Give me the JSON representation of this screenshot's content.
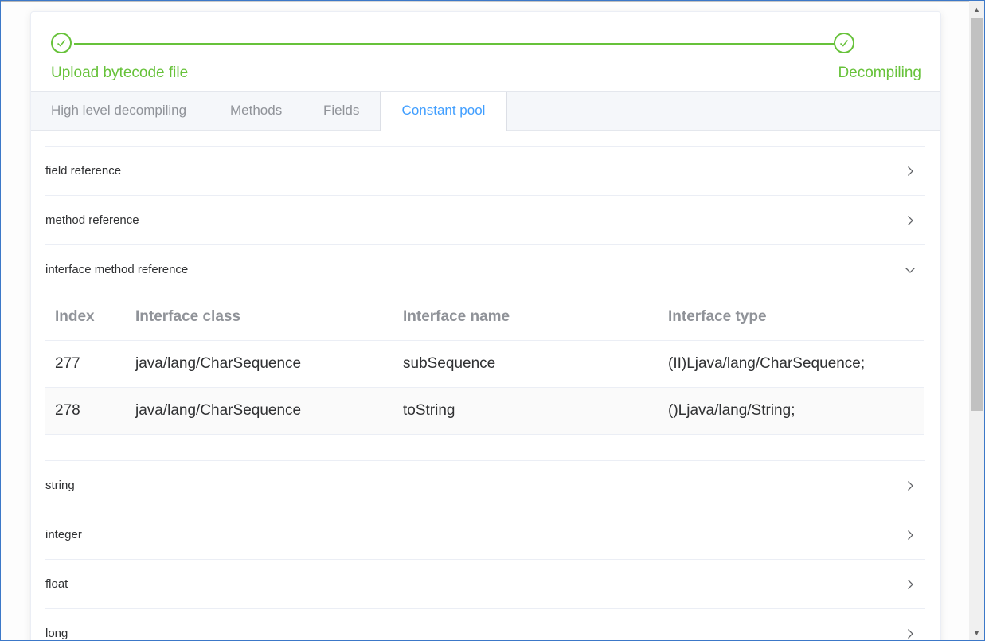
{
  "steps": [
    {
      "title": "Upload bytecode file",
      "status": "success"
    },
    {
      "title": "Decompiling",
      "status": "success"
    }
  ],
  "tabs": [
    {
      "label": "High level decompiling",
      "active": false
    },
    {
      "label": "Methods",
      "active": false
    },
    {
      "label": "Fields",
      "active": false
    },
    {
      "label": "Constant pool",
      "active": true
    }
  ],
  "collapse": {
    "items": [
      {
        "label": "field reference",
        "expanded": false
      },
      {
        "label": "method reference",
        "expanded": false
      },
      {
        "label": "interface method reference",
        "expanded": true
      },
      {
        "label": "string",
        "expanded": false
      },
      {
        "label": "integer",
        "expanded": false
      },
      {
        "label": "float",
        "expanded": false
      },
      {
        "label": "long",
        "expanded": false
      }
    ]
  },
  "interface_table": {
    "columns": [
      "Index",
      "Interface class",
      "Interface name",
      "Interface type"
    ],
    "rows": [
      [
        "277",
        "java/lang/CharSequence",
        "subSequence",
        "(II)Ljava/lang/CharSequence;"
      ],
      [
        "278",
        "java/lang/CharSequence",
        "toString",
        "()Ljava/lang/String;"
      ]
    ]
  },
  "colors": {
    "success": "#67c23a",
    "active_tab": "#409eff",
    "muted": "#909399",
    "text": "#303133"
  }
}
